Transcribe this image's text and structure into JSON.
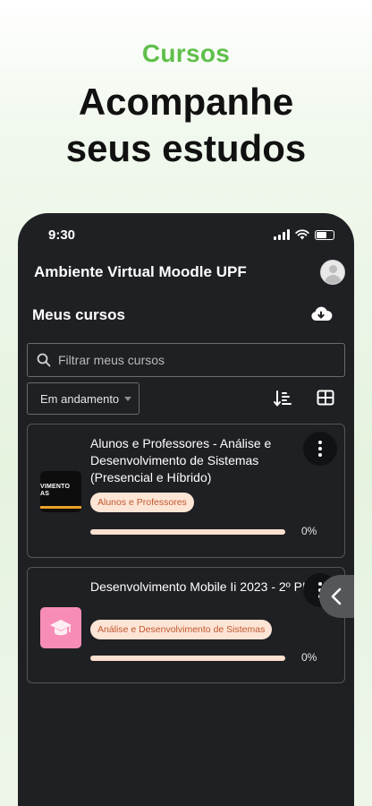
{
  "promo": {
    "eyebrow": "Cursos",
    "title_line1": "Acompanhe",
    "title_line2": "seus estudos"
  },
  "status_bar": {
    "time": "9:30"
  },
  "app": {
    "title": "Ambiente Virtual Moodle UPF"
  },
  "courses_section": {
    "title": "Meus cursos",
    "search_placeholder": "Filtrar meus cursos",
    "filter_value": "Em andamento",
    "icons": [
      "cloud-download-icon",
      "sort-icon",
      "grid-view-icon",
      "search-icon",
      "avatar-icon",
      "chevron-left-icon",
      "kebab-menu-icon",
      "graduation-cap-icon"
    ]
  },
  "courses": [
    {
      "name": "Alunos e Professores - Análise e Desenvolvimento de Sistemas (Presencial e Híbrido)",
      "category": "Alunos e Professores",
      "progress_label": "0%",
      "progress": 0,
      "thumb_text_line1": "VIMENTO",
      "thumb_text_line2": "AS"
    },
    {
      "name": "Desenvolvimento Mobile Ii 2023 - 2º PL",
      "category": "Análise e Desenvolvimento de Sistemas",
      "progress_label": "0%",
      "progress": 0
    }
  ],
  "colors": {
    "accent_green": "#5fbf4a",
    "app_background": "#1f2023",
    "tag_background": "#fde5d6",
    "progress_fill": "#f08a52",
    "thumb_pink": "#f78db6"
  }
}
